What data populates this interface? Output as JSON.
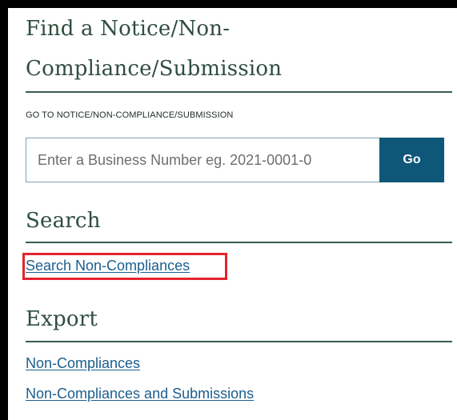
{
  "find": {
    "heading_line_1": "Find a Notice/Non-",
    "heading_line_2": "Compliance/Submission",
    "goto_label": "GO TO NOTICE/NON-COMPLIANCE/SUBMISSION",
    "input_placeholder": "Enter a Business Number eg. 2021-0001-0",
    "go_label": "Go"
  },
  "search": {
    "heading": "Search",
    "link_label": "Search Non-Compliances"
  },
  "export": {
    "heading": "Export",
    "links": [
      "Non-Compliances",
      "Non-Compliances and Submissions"
    ]
  },
  "colors": {
    "heading": "#2f4d3f",
    "rule": "#365f4b",
    "button": "#0f5779",
    "link": "#1a5e8e",
    "highlight": "#e5232f"
  }
}
